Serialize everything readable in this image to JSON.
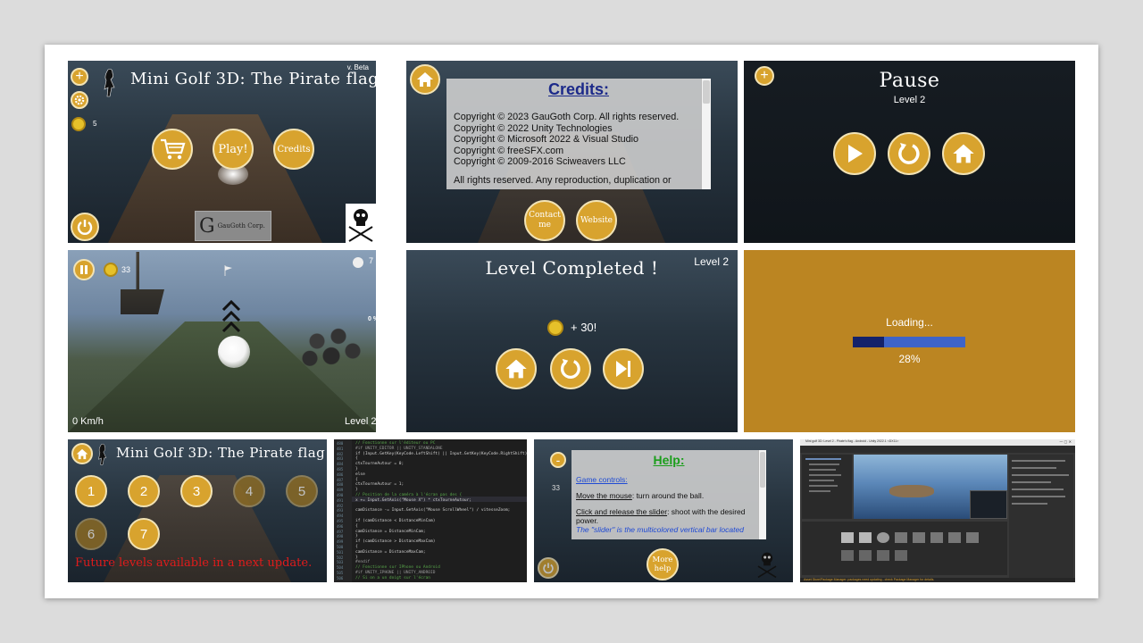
{
  "colors": {
    "gold": "#d8a32e",
    "loading_bg": "#bb8522",
    "progress_fill": "#3e64c8",
    "progress_done": "#14226a"
  },
  "tile1": {
    "title": "Mini Golf 3D: The Pirate flag",
    "version": "v. Beta",
    "coin_count": "5",
    "play_label": "Play!",
    "credits_label": "Credits",
    "logo_text": "GauGoth Corp.",
    "icons": [
      "plus-icon",
      "settings-icon",
      "coin-icon",
      "cart-icon",
      "power-icon",
      "skull-golf-icon"
    ]
  },
  "tile2": {
    "heading": "Credits:",
    "lines": [
      "Copyright © 2023 GauGoth Corp. All rights reserved.",
      "Copyright © 2022 Unity Technologies",
      "Copyright © Microsoft 2022 & Visual Studio",
      "Copyright © freeSFX.com",
      "Copyright © 2009-2016  Sciweavers LLC",
      "All rights reserved. Any reproduction, duplication or"
    ],
    "contact_label": "Contact me",
    "website_label": "Website"
  },
  "tile3": {
    "title": "Pause",
    "subtitle": "Level 2"
  },
  "tile4": {
    "coins": "33",
    "balls": "7",
    "power_percent": "0 %",
    "speed": "0 Km/h",
    "level": "Level 2"
  },
  "tile5": {
    "title": "Level Completed !",
    "level": "Level 2",
    "reward": "+ 30!"
  },
  "tile6": {
    "loading_text": "Loading...",
    "progress": 0.28,
    "percent_text": "28%"
  },
  "tile7": {
    "title": "Mini Golf 3D: The Pirate flag",
    "levels": [
      {
        "num": "1",
        "locked": false
      },
      {
        "num": "2",
        "locked": false
      },
      {
        "num": "3",
        "locked": false
      },
      {
        "num": "4",
        "locked": true
      },
      {
        "num": "5",
        "locked": true
      },
      {
        "num": "6",
        "locked": true
      },
      {
        "num": "7",
        "locked": false
      }
    ],
    "footer": "Future levels available in a next update."
  },
  "tile8": {
    "code": [
      "// Fonctionne sur l'éditeur ou PC",
      "#if UNITY_EDITOR || UNITY_STANDALONE",
      "if (Input.GetKey(KeyCode.LeftShift) || Input.GetKey(KeyCode.RightShift))",
      "{",
      "    ctxTourneAutour = 0;",
      "}",
      "else",
      "{",
      "    ctxTourneAutour = 1;",
      "}",
      "// Position de la caméra à l'écran pas des {",
      "x += Input.GetAxis(\"Mouse X\") * ctxTourneAutour;",
      "",
      "camDistance -= Input.GetAxis(\"Mouse ScrollWheel\") / vitesseZoom;",
      "",
      "if (camDistance < DistanceMinCam)",
      "{",
      "    camDistance = DistanceMinCam;",
      "}",
      "if (camDistance > DistanceMaxCam)",
      "{",
      "    camDistance = DistanceMaxCam;",
      "}",
      "#endif",
      "// Fonctionne sur IPhone ou Android",
      "#if UNITY_IPHONE || UNITY_ANDROID",
      "// Si on a un doigt sur l'écran"
    ]
  },
  "tile9": {
    "heading": "Help:",
    "section": "Game controls:",
    "mouse_term": "Move the mouse",
    "mouse_text": ": turn around the ball.",
    "slider_term": "Click and release the slider",
    "slider_text": ": shoot with the desired power.",
    "note": "The \"slider\" is the multicolored vertical bar located",
    "more_help_label": "More help",
    "side_number": "33"
  },
  "tile10": {
    "window_title": "Mini golf 3D: Level 2 - Pirate's flag - Android - Unity 2022.1 <DX11>",
    "status_text": "Asset Store/Package Manager: packages need updating - check Package Manager for details."
  }
}
